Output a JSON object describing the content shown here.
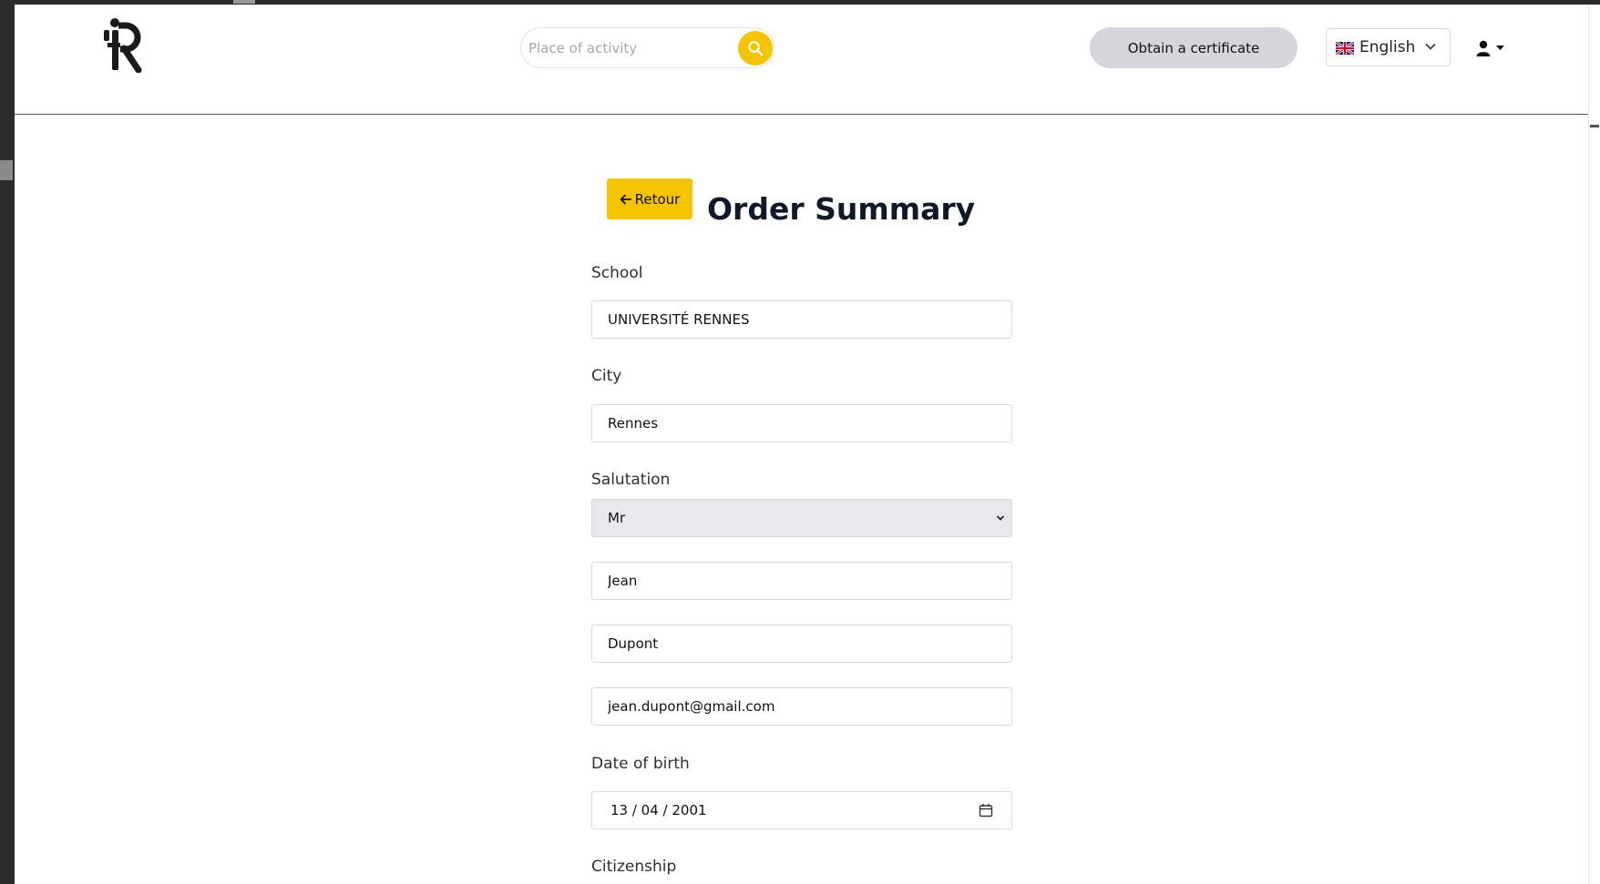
{
  "header": {
    "logo_text": "iR",
    "search": {
      "placeholder": "Place of activity",
      "value": ""
    },
    "certificate_label": "Obtain a certificate",
    "language": {
      "flag": "🇬🇧",
      "selected": "English"
    }
  },
  "main": {
    "back_label": "Retour",
    "title": "Order Summary",
    "fields": {
      "school": {
        "label": "School",
        "value": "UNIVERSITÉ RENNES"
      },
      "city": {
        "label": "City",
        "value": "Rennes"
      },
      "salutation": {
        "label": "Salutation",
        "value": "Mr"
      },
      "first_name": {
        "value": "Jean"
      },
      "last_name": {
        "value": "Dupont"
      },
      "email": {
        "value": "jean.dupont@gmail.com"
      },
      "dob": {
        "label": "Date of birth",
        "value": "13 / 04 / 2001"
      },
      "citizenship": {
        "label": "Citizenship"
      }
    }
  },
  "colors": {
    "accent": "#f5c400",
    "secondary_button": "#d4d6db",
    "select_bg": "#e8e9ed"
  },
  "icons": [
    "logo-icon",
    "search-icon",
    "chevron-down-icon",
    "user-icon",
    "caret-down-icon",
    "arrow-left-icon",
    "calendar-icon"
  ]
}
